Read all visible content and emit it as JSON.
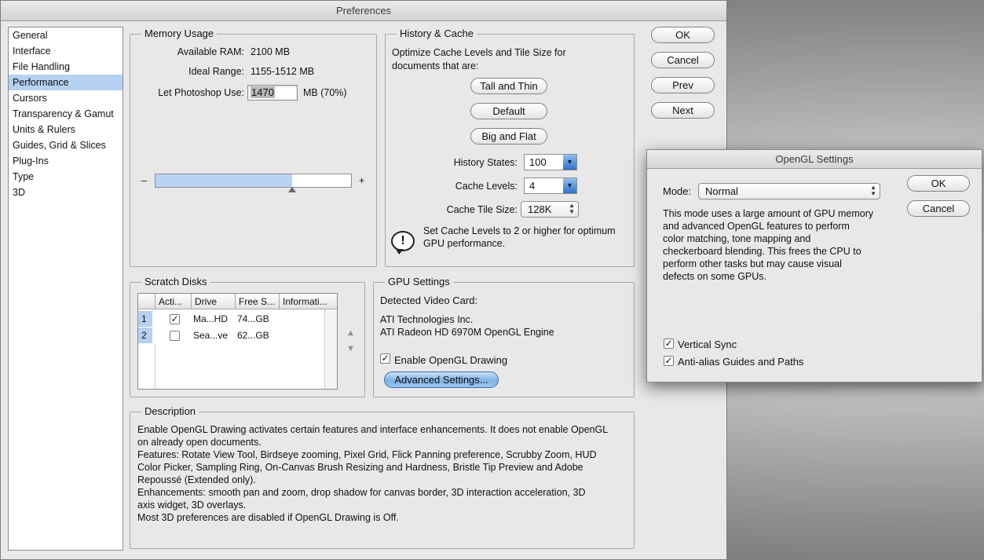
{
  "preferences": {
    "title": "Preferences",
    "sidebar": [
      {
        "label": "General",
        "selected": false
      },
      {
        "label": "Interface",
        "selected": false
      },
      {
        "label": "File Handling",
        "selected": false
      },
      {
        "label": "Performance",
        "selected": true
      },
      {
        "label": "Cursors",
        "selected": false
      },
      {
        "label": "Transparency & Gamut",
        "selected": false
      },
      {
        "label": "Units & Rulers",
        "selected": false
      },
      {
        "label": "Guides, Grid & Slices",
        "selected": false
      },
      {
        "label": "Plug-Ins",
        "selected": false
      },
      {
        "label": "Type",
        "selected": false
      },
      {
        "label": "3D",
        "selected": false
      }
    ],
    "buttons": {
      "ok": "OK",
      "cancel": "Cancel",
      "prev": "Prev",
      "next": "Next"
    },
    "memory": {
      "title": "Memory Usage",
      "available_label": "Available RAM:",
      "available_value": "2100 MB",
      "ideal_label": "Ideal Range:",
      "ideal_value": "1155-1512 MB",
      "use_label": "Let Photoshop Use:",
      "use_value": "1470",
      "use_suffix": "MB (70%)",
      "slider_min": "–",
      "slider_max": "+",
      "slider_fraction": 0.7
    },
    "history_cache": {
      "title": "History & Cache",
      "intro": "Optimize Cache Levels and Tile Size for documents that are:",
      "btn_tall": "Tall and Thin",
      "btn_default": "Default",
      "btn_big": "Big and Flat",
      "history_states_label": "History States:",
      "history_states_value": "100",
      "cache_levels_label": "Cache Levels:",
      "cache_levels_value": "4",
      "tile_size_label": "Cache Tile Size:",
      "tile_size_value": "128K",
      "warning": "Set Cache Levels to 2 or higher for optimum GPU performance."
    },
    "scratch": {
      "title": "Scratch Disks",
      "columns": [
        "Acti...",
        "Drive",
        "Free S...",
        "Informati..."
      ],
      "rows": [
        {
          "num": "1",
          "active": true,
          "drive": "Ma...HD",
          "free": "74...GB",
          "info": ""
        },
        {
          "num": "2",
          "active": false,
          "drive": "Sea...ve",
          "free": "62...GB",
          "info": ""
        }
      ]
    },
    "gpu": {
      "title": "GPU Settings",
      "detected_label": "Detected Video Card:",
      "vendor": "ATI Technologies Inc.",
      "card": "ATI Radeon HD 6970M OpenGL Engine",
      "enable_label": "Enable OpenGL Drawing",
      "enable_checked": true,
      "advanced_button": "Advanced Settings..."
    },
    "description": {
      "title": "Description",
      "lines": [
        "Enable OpenGL Drawing activates certain features and interface enhancements. It does not enable OpenGL",
        "on already open documents.",
        "Features: Rotate View Tool, Birdseye zooming, Pixel Grid, Flick Panning preference, Scrubby Zoom, HUD",
        "Color Picker, Sampling Ring, On-Canvas Brush Resizing and Hardness, Bristle Tip Preview and Adobe",
        "Repoussé (Extended only).",
        "Enhancements: smooth pan and zoom, drop shadow for canvas border, 3D interaction acceleration, 3D",
        "axis widget, 3D overlays.",
        "Most 3D preferences are disabled if OpenGL Drawing is Off."
      ]
    }
  },
  "opengl": {
    "title": "OpenGL Settings",
    "mode_label": "Mode:",
    "mode_value": "Normal",
    "ok": "OK",
    "cancel": "Cancel",
    "description_lines": [
      "This mode uses a large amount of GPU memory",
      "and advanced OpenGL features to perform",
      "color matching, tone mapping and",
      "checkerboard blending.  This frees the CPU to",
      "perform other tasks but may cause visual",
      "defects on some GPUs."
    ],
    "vsync_label": "Vertical Sync",
    "vsync_checked": true,
    "antialias_label": "Anti-alias Guides and Paths",
    "antialias_checked": true
  },
  "colors": {
    "selection": "#b5d2f2",
    "slider_fill": "#b8d3f5",
    "accent_blue": "#7fb2e6"
  }
}
